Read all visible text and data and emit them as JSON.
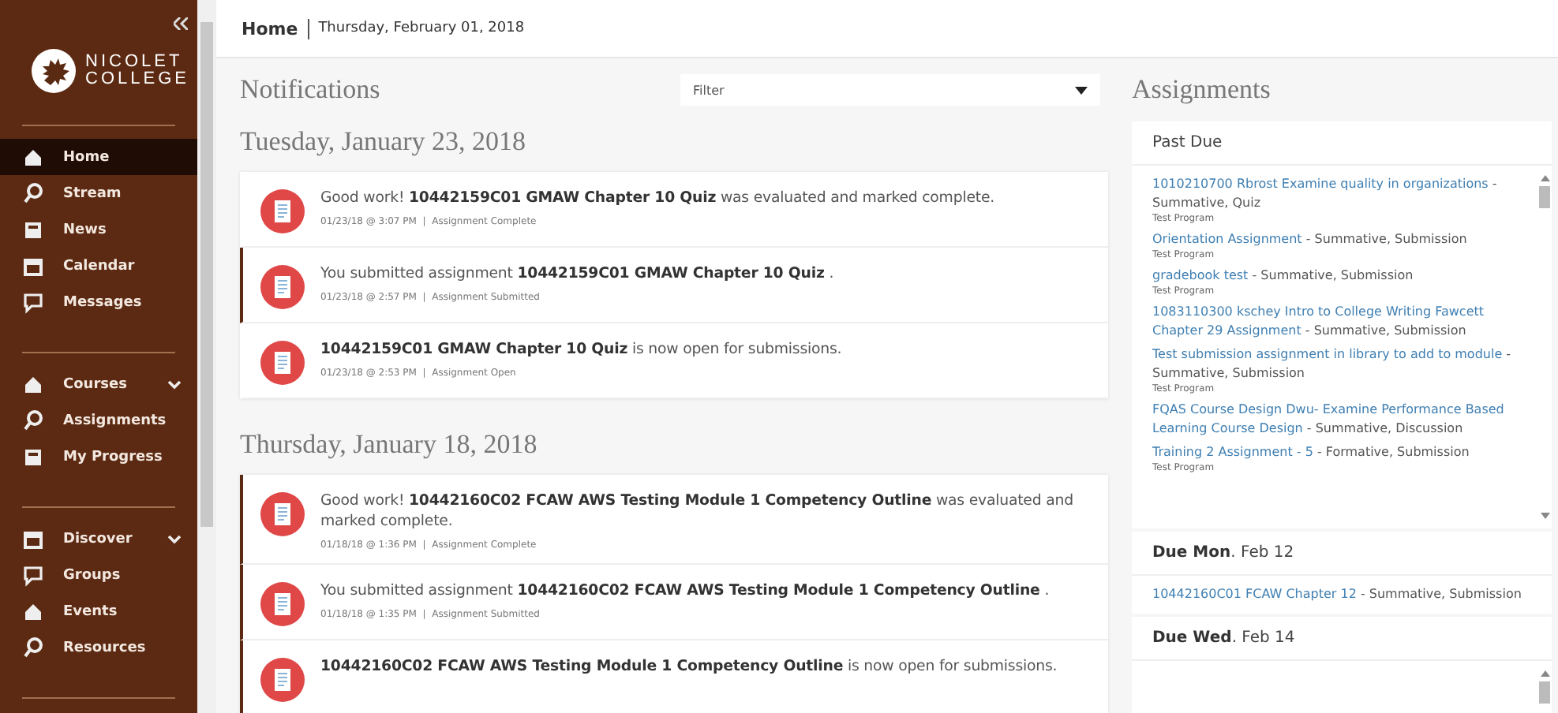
{
  "sidebar": {
    "logo": {
      "line_1": "NICOLET",
      "line_2": "COLLEGE"
    },
    "groups": [
      {
        "items": [
          {
            "label": "Home",
            "selected": true
          },
          {
            "label": "Stream",
            "selected": false
          },
          {
            "label": "News",
            "selected": false
          },
          {
            "label": "Calendar",
            "selected": false
          },
          {
            "label": "Messages",
            "selected": false
          }
        ]
      },
      {
        "items": [
          {
            "label": "Courses",
            "selected": false,
            "expandable": true
          },
          {
            "label": "Assignments",
            "selected": false
          },
          {
            "label": "My Progress",
            "selected": false
          }
        ]
      },
      {
        "items": [
          {
            "label": "Discover",
            "selected": false,
            "expandable": true
          },
          {
            "label": "Groups",
            "selected": false
          },
          {
            "label": "Events",
            "selected": false
          },
          {
            "label": "Resources",
            "selected": false
          }
        ]
      }
    ]
  },
  "header": {
    "title": "Home",
    "date": "Thursday, February 01, 2018"
  },
  "notifications": {
    "title": "Notifications",
    "filter": {
      "placeholder": "Filter"
    },
    "days": [
      {
        "date": "Tuesday, January 23, 2018",
        "items": [
          {
            "text": "Good work! **10442159C01 GMAW Chapter 10 Quiz** was evaluated and marked complete.",
            "meta": "01/23/18 @ 3:07 PM  |  Assignment Complete",
            "unread": false
          },
          {
            "text": "You submitted assignment **10442159C01 GMAW Chapter 10 Quiz** .",
            "meta": "01/23/18 @ 2:57 PM  |  Assignment Submitted",
            "unread": true
          },
          {
            "text": "**10442159C01 GMAW Chapter 10 Quiz** is now open for submissions.",
            "meta": "01/23/18 @ 2:53 PM  |  Assignment Open",
            "unread": false
          }
        ]
      },
      {
        "date": "Thursday, January 18, 2018",
        "items": [
          {
            "text": "Good work! **10442160C02 FCAW AWS Testing Module 1 Competency Outline** was evaluated and marked complete.",
            "meta": "01/18/18 @ 1:36 PM  |  Assignment Complete",
            "unread": true
          },
          {
            "text": "You submitted assignment **10442160C02 FCAW AWS Testing Module 1 Competency Outline** .",
            "meta": "01/18/18 @ 1:35 PM  |  Assignment Submitted",
            "unread": true
          },
          {
            "text": "**10442160C02 FCAW AWS Testing Module 1 Competency Outline** is now open for submissions.",
            "unread": true
          }
        ]
      }
    ]
  },
  "assignments": {
    "title": "Assignments",
    "sections": [
      {
        "heading": "Past Due",
        "scrollable": true,
        "items": [
          {
            "link": "1010210700 Rbrost Examine quality in organizations",
            "detail": "- Summative, Quiz",
            "program": "Test Program"
          },
          {
            "link": "Orientation Assignment",
            "detail": "- Summative, Submission",
            "program": "Test Program"
          },
          {
            "link": "gradebook test",
            "detail": "- Summative, Submission",
            "program": "Test Program"
          },
          {
            "link": "1083110300 kschey Intro to College Writing Fawcett Chapter 29 Assignment",
            "detail": "- Summative, Submission"
          },
          {
            "link": "Test submission assignment in library to add to module",
            "detail": "- Summative, Submission",
            "program": "Test Program"
          },
          {
            "link": "FQAS Course Design Dwu- Examine Performance Based Learning Course Design",
            "detail": "- Summative, Discussion"
          },
          {
            "link": "Training 2 Assignment - 5",
            "detail": "- Formative, Submission",
            "program": "Test Program"
          }
        ]
      },
      {
        "heading": "**Due Mon**. Feb 12",
        "scrollable": false,
        "items": [
          {
            "link": "10442160C01 FCAW Chapter 12",
            "detail": "- Summative, Submission"
          }
        ]
      },
      {
        "heading": "**Due Wed**. Feb 14",
        "scrollable": true
      }
    ]
  }
}
